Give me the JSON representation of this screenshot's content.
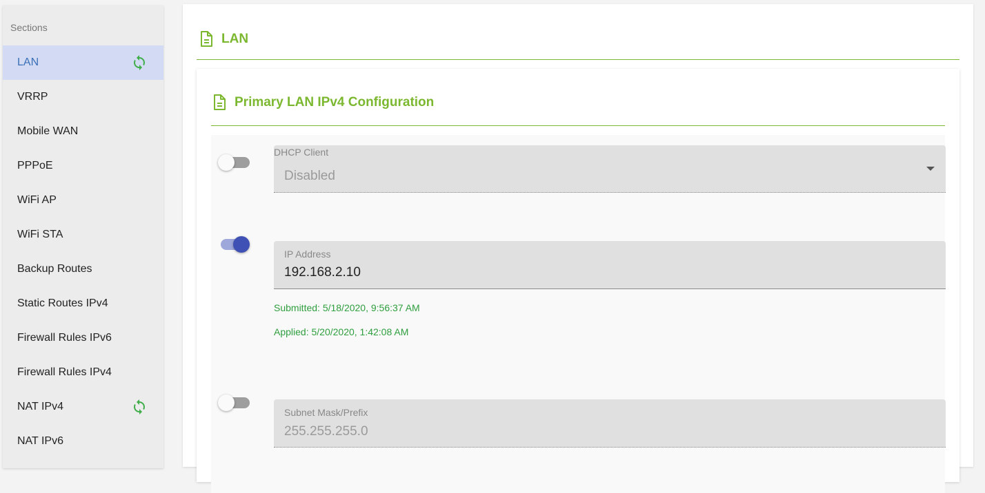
{
  "sidebar": {
    "header": "Sections",
    "items": [
      {
        "label": "LAN",
        "active": true,
        "sync": true
      },
      {
        "label": "VRRP"
      },
      {
        "label": "Mobile WAN"
      },
      {
        "label": "PPPoE"
      },
      {
        "label": "WiFi AP"
      },
      {
        "label": "WiFi STA"
      },
      {
        "label": "Backup Routes"
      },
      {
        "label": "Static Routes IPv4"
      },
      {
        "label": "Firewall Rules IPv6"
      },
      {
        "label": "Firewall Rules IPv4"
      },
      {
        "label": "NAT IPv4",
        "sync": true
      },
      {
        "label": "NAT IPv6"
      }
    ],
    "sync_icon": "sync-icon"
  },
  "main": {
    "section_title": "LAN",
    "section_icon": "document-icon",
    "card": {
      "title": "Primary LAN IPv4 Configuration",
      "title_icon": "document-icon",
      "fields": {
        "dhcp": {
          "label": "DHCP Client",
          "value": "Disabled",
          "enabled": false,
          "control": "dropdown"
        },
        "ip": {
          "label": "IP Address",
          "value": "192.168.2.10",
          "enabled": true,
          "submitted": "Submitted: 5/18/2020, 9:56:37 AM",
          "applied": "Applied: 5/20/2020, 1:42:08 AM"
        },
        "subnet": {
          "label": "Subnet Mask/Prefix",
          "value": "255.255.255.0",
          "enabled": false
        }
      }
    }
  },
  "colors": {
    "accent_green": "#7cb82f",
    "status_green": "#2e9e3e",
    "toggle_on": "#3f51b5",
    "active_item_bg": "#d2dbf3",
    "active_item_text": "#3a6fb7"
  }
}
